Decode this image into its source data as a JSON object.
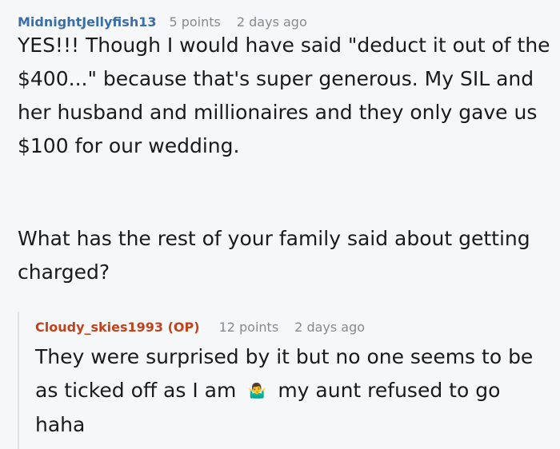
{
  "comment": {
    "author": "MidnightJellyfish13",
    "points": "5 points",
    "time": "2 days ago",
    "paragraph1": "YES!!! Though I would have said \"deduct it out of the $400...\" because that's super generous. My SIL and her husband and millionaires and they only gave us $100 for our wedding.",
    "paragraph2": "What has the rest of your family said about getting charged?"
  },
  "reply": {
    "author": "Cloudy_skies1993 (OP)",
    "points": "12 points",
    "time": "2 days ago",
    "text_before": "They were surprised by it but no one seems to be as ticked off as I am",
    "emoji": "🤷‍♂️",
    "text_after": "my aunt refused to go haha"
  },
  "colors": {
    "author": "#3b6ea8",
    "op_author": "#c0431d",
    "meta": "#878a8c",
    "thread_line": "#e0e2e4"
  }
}
